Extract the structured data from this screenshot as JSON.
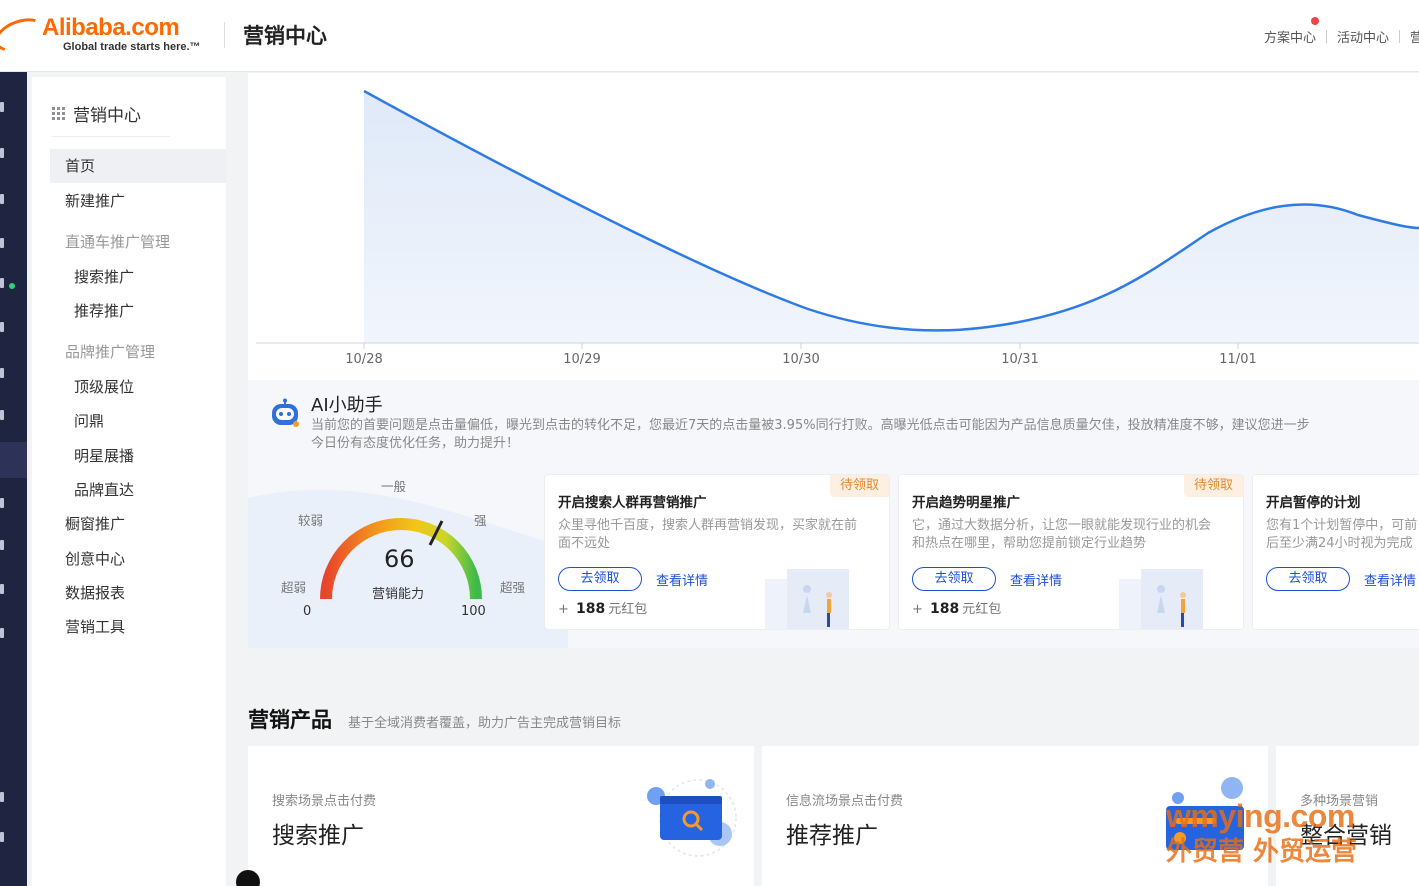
{
  "header": {
    "logo_text": "Alibaba.com",
    "logo_tagline": "Global trade starts here.™",
    "title": "营销中心",
    "links": [
      "方案中心",
      "活动中心",
      "营"
    ]
  },
  "sidebar": {
    "title": "营销中心",
    "items": [
      {
        "label": "首页",
        "kind": "active"
      },
      {
        "label": "新建推广",
        "kind": "item"
      },
      {
        "label": "直通车推广管理",
        "kind": "group"
      },
      {
        "label": "搜索推广",
        "kind": "sub"
      },
      {
        "label": "推荐推广",
        "kind": "sub"
      },
      {
        "label": "品牌推广管理",
        "kind": "group"
      },
      {
        "label": "顶级展位",
        "kind": "sub"
      },
      {
        "label": "问鼎",
        "kind": "sub"
      },
      {
        "label": "明星展播",
        "kind": "sub"
      },
      {
        "label": "品牌直达",
        "kind": "sub"
      },
      {
        "label": "橱窗推广",
        "kind": "item"
      },
      {
        "label": "创意中心",
        "kind": "item"
      },
      {
        "label": "数据报表",
        "kind": "item"
      },
      {
        "label": "营销工具",
        "kind": "item"
      }
    ]
  },
  "chart_data": {
    "type": "area",
    "x": [
      "10/28",
      "10/29",
      "10/30",
      "10/31",
      "11/01"
    ],
    "line_color": "#2f7be6"
  },
  "ai": {
    "title": "AI小助手",
    "description": "当前您的首要问题是点击量偏低，曝光到点击的转化不足，您最近7天的点击量被3.95%同行打败。高曝光低点击可能因为产品信息质量欠佳，投放精准度不够，建议您进一步\n今日份有态度优化任务，助力提升！",
    "gauge": {
      "score": 66,
      "score_label": "营销能力",
      "min": "0",
      "max": "100",
      "labels": {
        "very_weak": "超弱",
        "weak": "较弱",
        "normal": "一般",
        "strong": "强",
        "very_strong": "超强"
      }
    },
    "cards": [
      {
        "badge": "待领取",
        "title": "开启搜索人群再营销推广",
        "desc": "众里寻他千百度，搜索人群再营销发现，买家就在前\n面不远处",
        "claim": "去领取",
        "detail": "查看详情",
        "reward_prefix": "+",
        "reward_amount": "188",
        "reward_unit": "元红包"
      },
      {
        "badge": "待领取",
        "title": "开启趋势明星推广",
        "desc": "它，通过大数据分析，让您一眼就能发现行业的机会\n和热点在哪里，帮助您提前锁定行业趋势",
        "claim": "去领取",
        "detail": "查看详情",
        "reward_prefix": "+",
        "reward_amount": "188",
        "reward_unit": "元红包"
      },
      {
        "badge": "",
        "title": "开启暂停的计划",
        "desc": "您有1个计划暂停中，可前\n后至少满24小时视为完成",
        "claim": "去领取",
        "detail": "查看详情",
        "reward_prefix": "",
        "reward_amount": "",
        "reward_unit": ""
      }
    ]
  },
  "products": {
    "title": "营销产品",
    "subtitle": "基于全域消费者覆盖，助力广告主完成营销目标",
    "cards": [
      {
        "small": "搜索场景点击付费",
        "big": "搜索推广"
      },
      {
        "small": "信息流场景点击付费",
        "big": "推荐推广"
      },
      {
        "small": "多种场景营销",
        "big": "整合营销"
      }
    ]
  },
  "watermark": {
    "line1": "wmying.com",
    "line2": "外贸营 外贸运营"
  },
  "colors": {
    "brand": "#ff6a00",
    "primary_blue": "#1d4fd8",
    "badge_orange": "#e3892e",
    "sidebar_dark": "#1f2440"
  }
}
